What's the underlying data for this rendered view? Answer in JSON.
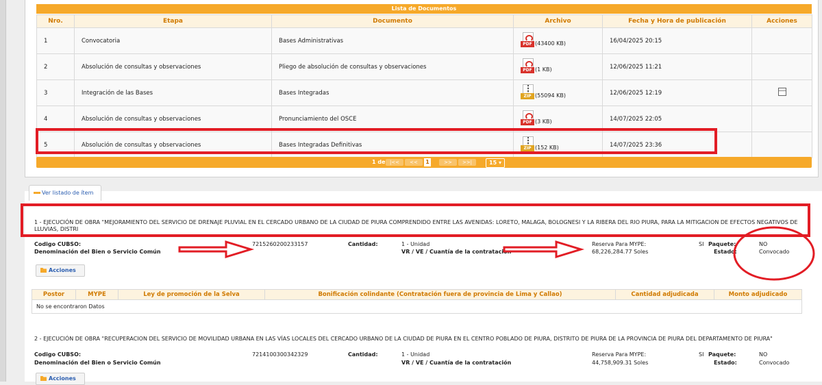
{
  "documents": {
    "title": "Lista de Documentos",
    "headers": [
      "Nro.",
      "Etapa",
      "Documento",
      "Archivo",
      "Fecha y Hora de publicación",
      "Acciones"
    ],
    "rows": [
      {
        "nro": "1",
        "etapa": "Convocatoria",
        "documento": "Bases Administrativas",
        "file_type": "pdf",
        "size": "(43400 KB)",
        "fecha": "16/04/2025 20:15",
        "has_action": false
      },
      {
        "nro": "2",
        "etapa": "Absolución de consultas y observaciones",
        "documento": "Pliego de absolución de consultas y observaciones",
        "file_type": "pdf",
        "size": "(1 KB)",
        "fecha": "12/06/2025 11:21",
        "has_action": false
      },
      {
        "nro": "3",
        "etapa": "Integración de las Bases",
        "documento": "Bases Integradas",
        "file_type": "zip",
        "size": "(55094 KB)",
        "fecha": "12/06/2025 12:19",
        "has_action": true
      },
      {
        "nro": "4",
        "etapa": "Absolución de consultas y observaciones",
        "documento": "Pronunciamiento del OSCE",
        "file_type": "pdf",
        "size": "(3 KB)",
        "fecha": "14/07/2025 22:05",
        "has_action": false
      },
      {
        "nro": "5",
        "etapa": "Absolución de consultas y observaciones",
        "documento": "Bases Integradas Definitivas",
        "file_type": "zip",
        "size": "(152 KB)",
        "fecha": "14/07/2025 23:36",
        "has_action": false
      }
    ],
    "pager": {
      "text": "1 de 1",
      "first": "|<<",
      "prev": "<<",
      "current": "1",
      "next": ">>",
      "last": ">>|",
      "page_size": "15"
    }
  },
  "items_tab": {
    "label": "Ver listado de ítem"
  },
  "items": [
    {
      "title": "1 - EJECUCIÓN DE OBRA \"MEJORAMIENTO DEL SERVICIO DE DRENAJE PLUVIAL EN EL CERCADO URBANO DE LA CIUDAD DE PIURA COMPRENDIDO ENTRE LAS AVENIDAS: LORETO, MALAGA, BOLOGNESI Y LA RIBERA DEL RIO PIURA, PARA LA MITIGACION DE EFECTOS NEGATIVOS DE LLUVIAS, DISTRI",
      "codigo_label": "Codigo CUBSO:",
      "codigo": "7215260200233157",
      "denominacion_label": "Denominación del Bien o Servicio Común",
      "cantidad_label": "Cantidad:",
      "cantidad": "1 - Unidad",
      "vr_label": "VR / VE / Cuantía de la contratación",
      "reserva_label": "Reserva Para MYPE:",
      "reserva": "SI",
      "monto": "68,226,284.77 Soles",
      "paquete_label": "Paquete:",
      "paquete": "NO",
      "estado_label": "Estado:",
      "estado": "Convocado",
      "acciones": "Acciones"
    },
    {
      "title": "2 - EJECUCIÓN DE OBRA \"RECUPERACION DEL SERVICIO DE MOVILIDAD URBANA EN LAS VÍAS LOCALES DEL CERCADO URBANO DE LA CIUDAD DE PIURA EN EL CENTRO POBLADO DE PIURA, DISTRITO DE PIURA DE LA PROVINCIA DE PIURA DEL DEPARTAMENTO DE PIURA\"",
      "codigo_label": "Codigo CUBSO:",
      "codigo": "7214100300342329",
      "denominacion_label": "Denominación del Bien o Servicio Común",
      "cantidad_label": "Cantidad:",
      "cantidad": "1 - Unidad",
      "vr_label": "VR / VE / Cuantía de la contratación",
      "reserva_label": "Reserva Para MYPE:",
      "reserva": "SI",
      "monto": "44,758,909.31 Soles",
      "paquete_label": "Paquete:",
      "paquete": "NO",
      "estado_label": "Estado:",
      "estado": "Convocado",
      "acciones": "Acciones"
    }
  ],
  "postor_table": {
    "headers": [
      "Postor",
      "MYPE",
      "Ley de promoción de la Selva",
      "Bonificación colindante (Contratación fuera de provincia de Lima y Callao)",
      "Cantidad adjudicada",
      "Monto adjudicado"
    ],
    "empty": "No se encontraron Datos"
  },
  "colors": {
    "accent": "#f6a92a",
    "annotation": "#e21d25",
    "link": "#2a5db0"
  }
}
